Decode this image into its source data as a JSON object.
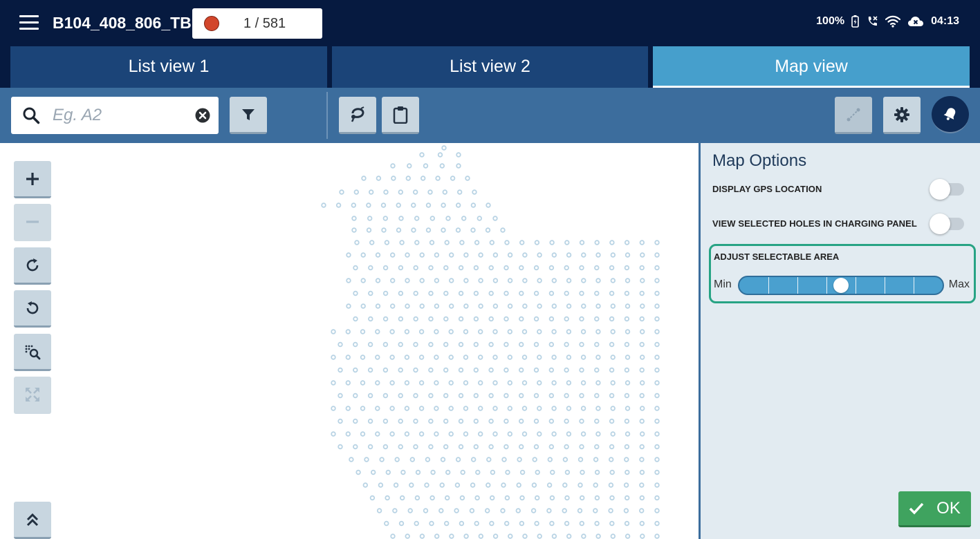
{
  "header": {
    "menu_icon": "hamburger-icon",
    "blast_id": "B104_408_806_TB",
    "counter_text": "1 / 581",
    "counter_status_color": "#d2462b",
    "status": {
      "battery": "100%",
      "time": "04:13"
    }
  },
  "tabs": [
    {
      "label": "List view 1",
      "active": false
    },
    {
      "label": "List view 2",
      "active": false
    },
    {
      "label": "Map view",
      "active": true
    }
  ],
  "toolbar": {
    "search_placeholder": "Eg. A2",
    "search_value": ""
  },
  "map": {
    "hole_color": "#b8d3e4"
  },
  "panel": {
    "title": "Map Options",
    "options": [
      {
        "label": "DISPLAY GPS LOCATION",
        "enabled": false
      },
      {
        "label": "VIEW SELECTED HOLES IN CHARGING PANEL",
        "enabled": false
      }
    ],
    "area": {
      "label": "ADJUST SELECTABLE AREA",
      "min_label": "Min",
      "max_label": "Max",
      "steps": 7,
      "value_step": 3
    },
    "ok_label": "OK"
  },
  "colors": {
    "header_bg": "#061a40",
    "tab_bg": "#1b4478",
    "tab_active_bg": "#469fcc",
    "toolbar_bg": "#3c6d9d",
    "accent_green": "#27a384",
    "ok_green": "#3fa35f"
  }
}
